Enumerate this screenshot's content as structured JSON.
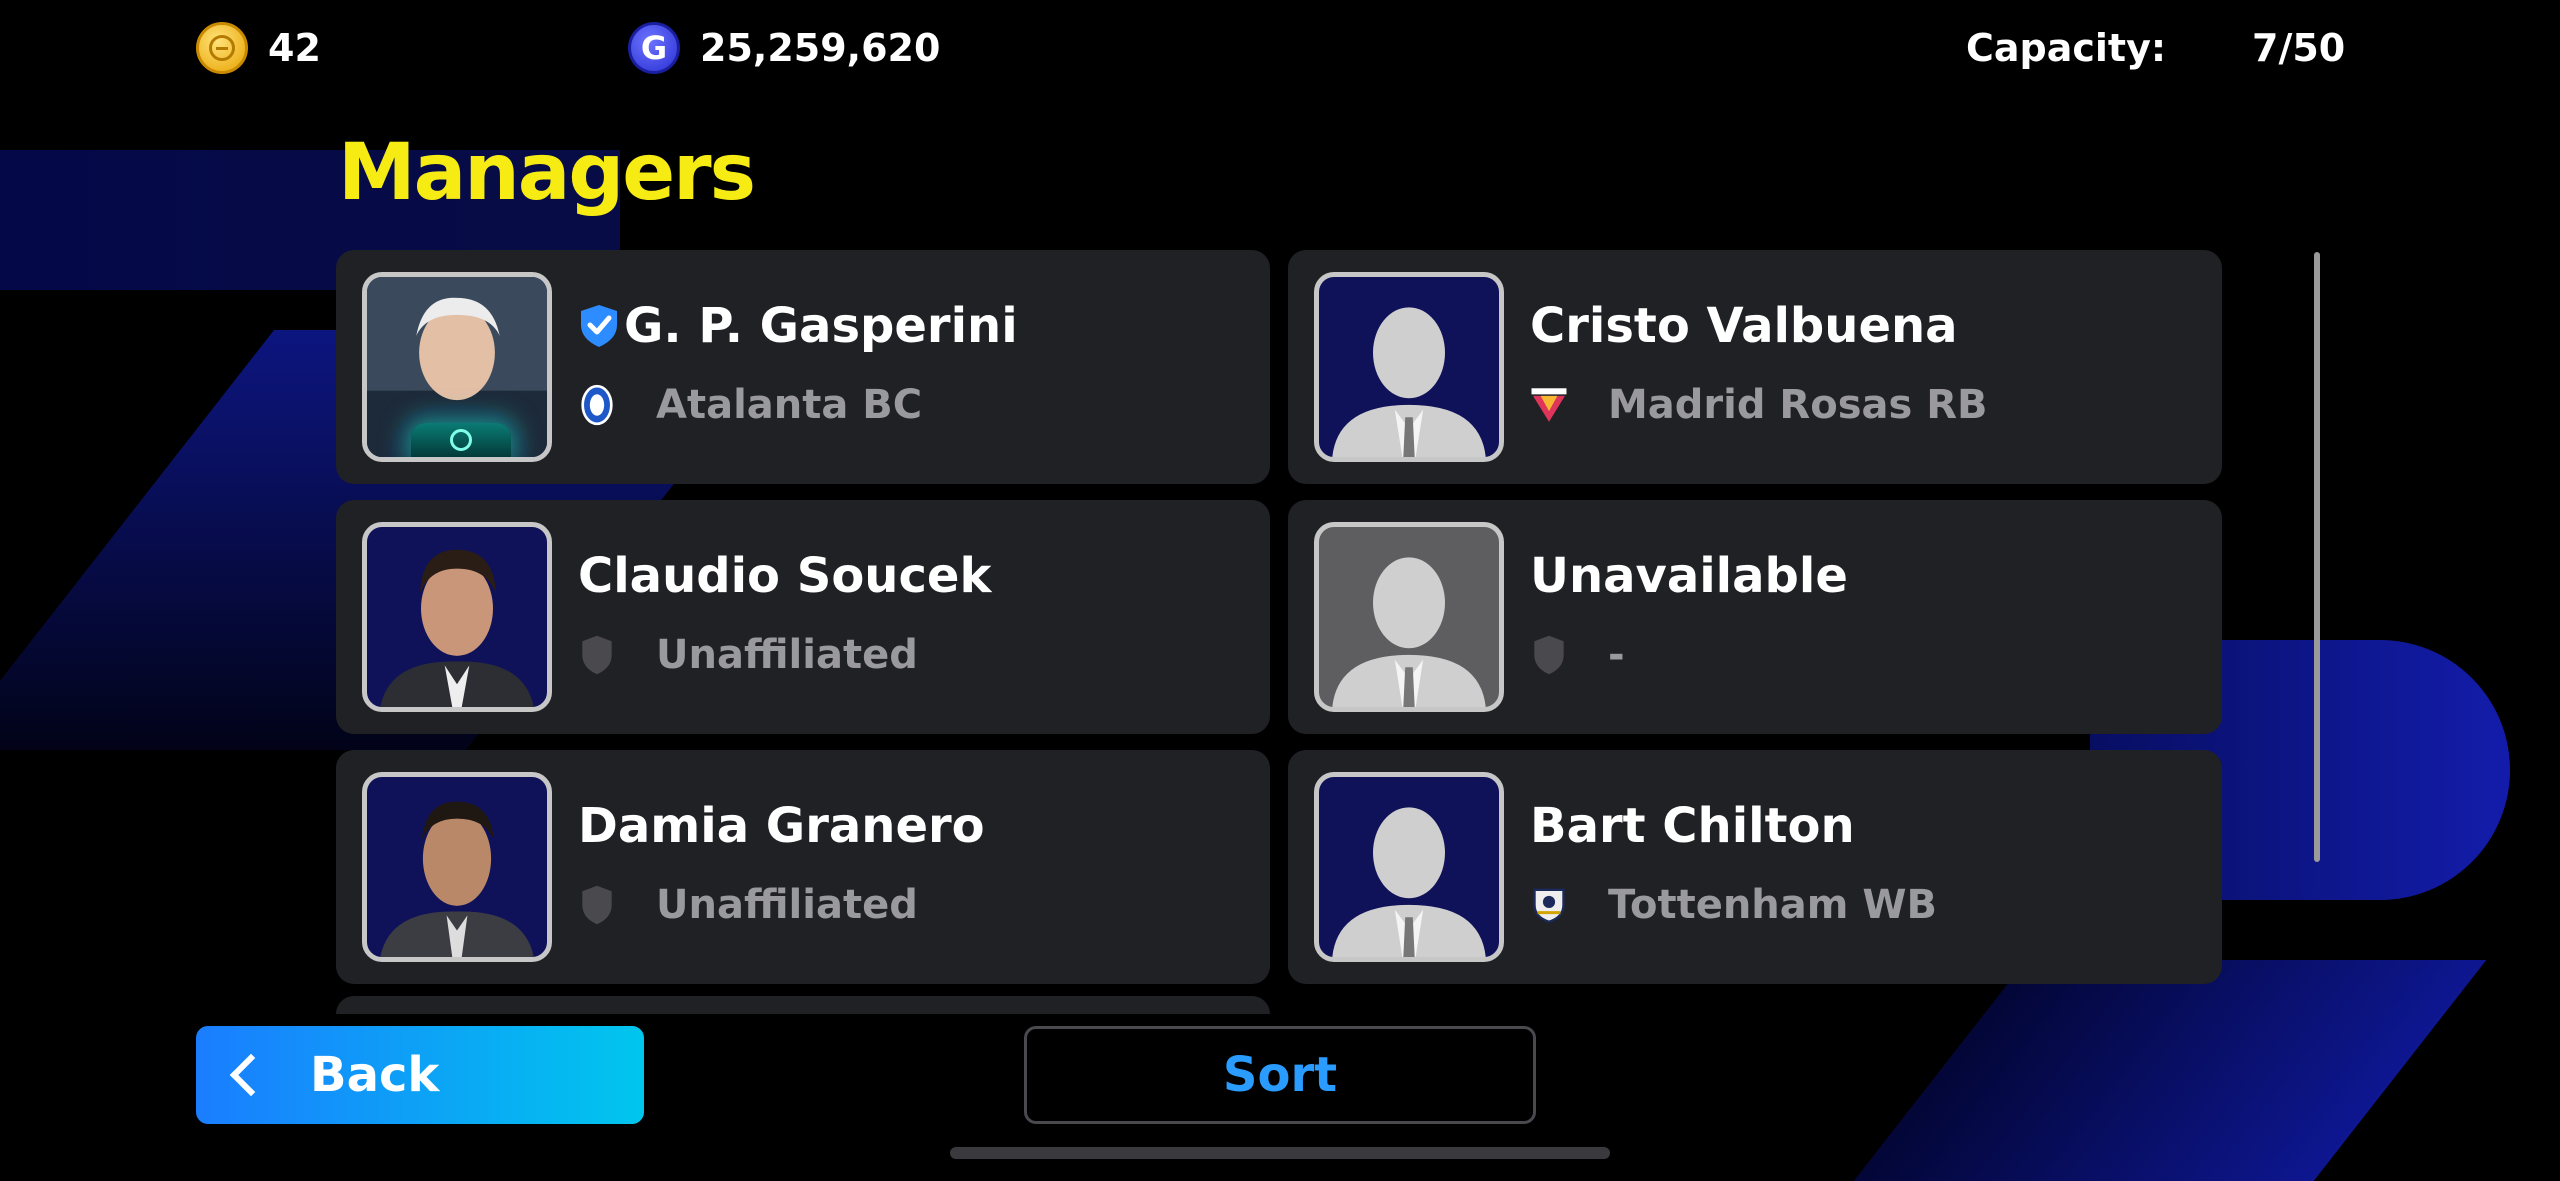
{
  "topbar": {
    "coins": {
      "icon": "efootball-coin-icon",
      "value": "42"
    },
    "gp": {
      "icon": "gp-coin-icon",
      "symbol": "G",
      "value": "25,259,620"
    },
    "capacity": {
      "label": "Capacity:",
      "value": "7/50"
    }
  },
  "title": "Managers",
  "managers": [
    {
      "name": "G. P. Gasperini",
      "club": "Atalanta BC",
      "verified": true,
      "portrait": "photo",
      "badge": "atalanta-crest-icon"
    },
    {
      "name": "Cristo Valbuena",
      "club": "Madrid Rosas RB",
      "verified": false,
      "portrait": "silhouette",
      "badge": "madrid-rosas-crest-icon"
    },
    {
      "name": "Claudio Soucek",
      "club": "Unaffiliated",
      "verified": false,
      "portrait": "photo",
      "badge": "empty-shield-icon"
    },
    {
      "name": "Unavailable",
      "club": "-",
      "verified": false,
      "portrait": "silhouette-gray",
      "badge": "empty-shield-icon"
    },
    {
      "name": "Damia Granero",
      "club": "Unaffiliated",
      "verified": false,
      "portrait": "photo",
      "badge": "empty-shield-icon"
    },
    {
      "name": "Bart Chilton",
      "club": "Tottenham WB",
      "verified": false,
      "portrait": "silhouette",
      "badge": "tottenham-crest-icon"
    }
  ],
  "buttons": {
    "back": "Back",
    "sort": "Sort"
  },
  "colors": {
    "title": "#f6ec14",
    "accent": "#1a7dff",
    "sort_text": "#2a9bff",
    "card_bg": "#202125"
  }
}
